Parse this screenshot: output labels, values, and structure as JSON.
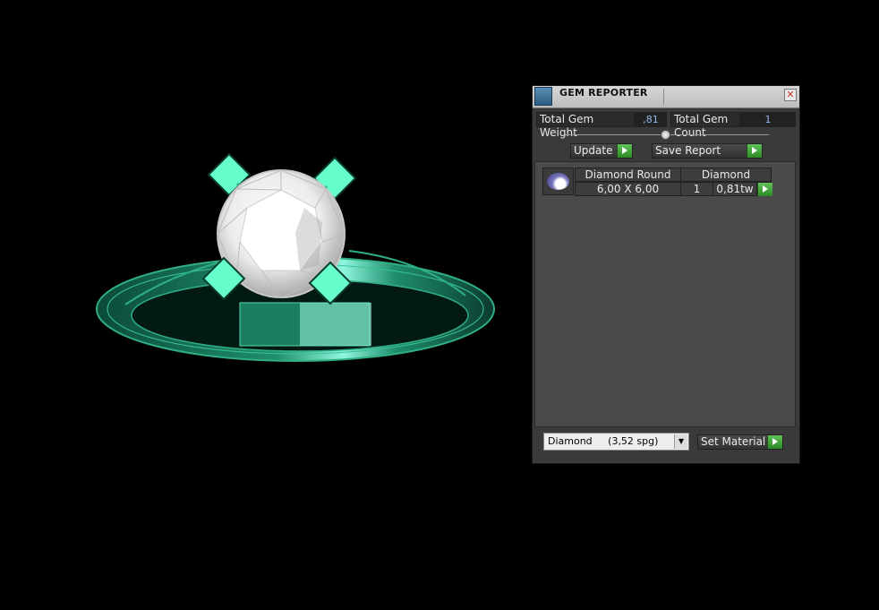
{
  "window": {
    "title": "GEM REPORTER"
  },
  "stats": {
    "weight_label": "Total Gem Weight",
    "weight_value": ",81",
    "count_label": "Total Gem Count",
    "count_value": "1"
  },
  "actions": {
    "update_label": "Update",
    "save_label": "Save Report"
  },
  "gem_row": {
    "shape": "Diamond Round",
    "material": "Diamond",
    "size": "6,00 X 6,00",
    "quantity": "1",
    "weight": "0,81tw"
  },
  "material_select": {
    "value": "Diamond     (3,52 spg)"
  },
  "set_material_label": "Set Material",
  "colors": {
    "ring_green": "#2fae84",
    "prong_mint": "#66ffcc",
    "go_button_green": "#3fa83a",
    "value_blue": "#8fb7e8"
  }
}
